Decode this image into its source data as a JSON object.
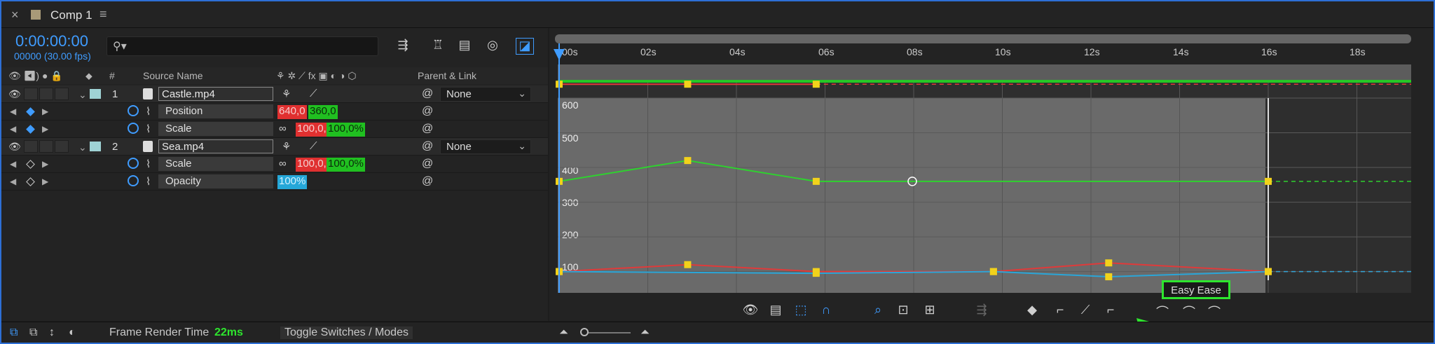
{
  "tab": {
    "close": "×",
    "title": "Comp 1",
    "menu": "≡"
  },
  "timecode": {
    "main": "0:00:00:00",
    "sub": "00000 (30.00 fps)"
  },
  "search": {
    "placeholder": ""
  },
  "columns": {
    "num": "#",
    "source_name": "Source Name",
    "parent_link": "Parent & Link"
  },
  "layers": [
    {
      "num": "1",
      "name": "Castle.mp4",
      "parent": "None",
      "props": [
        {
          "name": "Position",
          "values": [
            "640,0",
            "360,0"
          ],
          "colors": [
            "red",
            "green"
          ]
        },
        {
          "name": "Scale",
          "values": [
            "100,0,",
            "100,0%"
          ],
          "colors": [
            "red",
            "green"
          ]
        }
      ]
    },
    {
      "num": "2",
      "name": "Sea.mp4",
      "parent": "None",
      "props": [
        {
          "name": "Scale",
          "values": [
            "100,0,",
            "100,0%"
          ],
          "colors": [
            "red",
            "green"
          ]
        },
        {
          "name": "Opacity",
          "values": [
            "100%"
          ],
          "colors": [
            "cyan"
          ]
        }
      ]
    }
  ],
  "ruler": [
    "00s",
    "02s",
    "04s",
    "06s",
    "08s",
    "10s",
    "12s",
    "14s",
    "16s",
    "18s"
  ],
  "graph_y_labels": [
    "600",
    "500",
    "400",
    "300",
    "200",
    "100"
  ],
  "tooltip": "Easy Ease",
  "bottom": {
    "frame_render_label": "Frame Render Time",
    "frame_render_value": "22ms",
    "toggle": "Toggle Switches / Modes"
  },
  "colors": {
    "accent": "#3f9cff",
    "red_curve": "#e03a3a",
    "green_curve": "#2fd12f",
    "cyan_curve": "#2aa6d8",
    "keyframe": "#f2d21b",
    "highlight": "#2ee52e"
  },
  "chart_data": {
    "type": "line",
    "x_unit": "s",
    "xlim": [
      0,
      19
    ],
    "ylim": [
      0,
      640
    ],
    "series": [
      {
        "name": "Castle Position X",
        "color": "red",
        "x": [
          0,
          2.9,
          5.8
        ],
        "y": [
          640,
          640,
          640
        ]
      },
      {
        "name": "Castle Position Y",
        "color": "green",
        "x": [
          0,
          2.9,
          5.8,
          16
        ],
        "y": [
          360,
          420,
          360,
          360
        ]
      },
      {
        "name": "Castle Scale",
        "color": "red",
        "x": [
          0,
          2.9,
          5.8,
          9.8,
          12.4,
          16
        ],
        "y": [
          100,
          120,
          100,
          100,
          125,
          100
        ]
      },
      {
        "name": "Sea Opacity",
        "color": "cyan",
        "x": [
          0,
          5.8,
          9.8,
          12.4,
          16
        ],
        "y": [
          100,
          95,
          100,
          85,
          100
        ]
      }
    ]
  }
}
